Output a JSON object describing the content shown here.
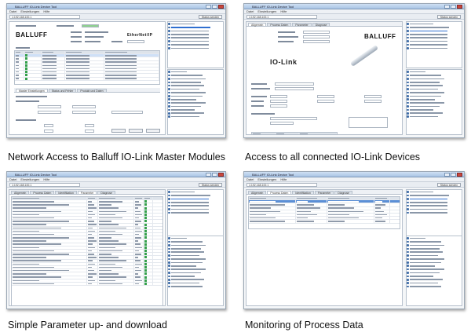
{
  "panels": [
    {
      "caption": "Network Access to Balluff IO-Link Master Modules",
      "window_title": "BALLUFF IO-Link Device Tool",
      "menu": [
        "Datei",
        "Einstellungen",
        "Hilfe"
      ],
      "address": "1:192.168.100.1",
      "logo": "BALLUFF",
      "badge": "EtherNet/IP",
      "tabs": [
        "Master Einstellungen",
        "Status und Fehler",
        "Produkt und Daten"
      ],
      "button_label": "Status senden"
    },
    {
      "caption": "Access to all connected IO-Link Devices",
      "window_title": "BALLUFF IO-Link Device Tool",
      "menu": [
        "Datei",
        "Einstellungen",
        "Hilfe"
      ],
      "address": "1:192.168.100.1",
      "logo": "BALLUFF",
      "logo2": "IO-Link",
      "tabs": [
        "Allgemein",
        "Prozess Daten",
        "Parameter",
        "Diagnose"
      ],
      "button_label": "Status senden"
    },
    {
      "caption": "Simple Parameter up- and download",
      "window_title": "BALLUFF IO-Link Device Tool",
      "menu": [
        "Datei",
        "Einstellungen",
        "Hilfe"
      ],
      "address": "1:192.168.100.1",
      "tabs": [
        "Allgemein",
        "Prozess Daten",
        "Identifikation",
        "Parameter",
        "Diagnose"
      ],
      "button_label": "Status senden"
    },
    {
      "caption": "Monitoring of Process Data",
      "window_title": "BALLUFF IO-Link Device Tool",
      "menu": [
        "Datei",
        "Einstellungen",
        "Hilfe"
      ],
      "address": "1:192.168.100.1",
      "tabs": [
        "Allgemein",
        "Prozess Daten",
        "Identifikation",
        "Parameter",
        "Diagnose"
      ],
      "button_label": "Status senden"
    }
  ],
  "colors": {
    "window_frame": "#9aa7b5",
    "titlebar": "#a9c4e4",
    "selection": "#2f6fd0",
    "ok_green": "#34a04b"
  }
}
